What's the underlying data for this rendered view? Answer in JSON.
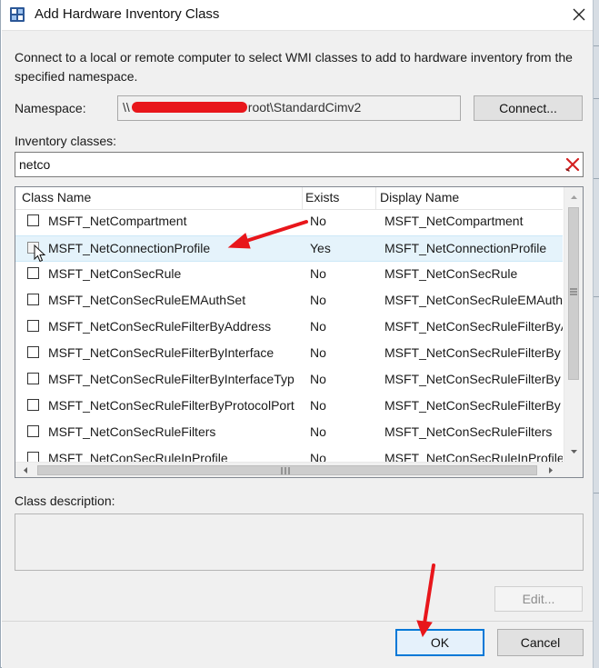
{
  "window": {
    "title": "Add Hardware Inventory Class",
    "close_glyph": "✕",
    "icon": "wmi-inventory-icon"
  },
  "intro": {
    "text": "Connect to a local or remote computer to select WMI classes to add to hardware inventory from the specified namespace."
  },
  "namespace": {
    "label": "Namespace:",
    "value_prefix": "\\\\",
    "value_suffix": "root\\StandardCimv2",
    "redacted": true,
    "connect_label": "Connect..."
  },
  "inventory": {
    "label": "Inventory classes:",
    "filter_value": "netco",
    "clear_icon": "clear-filter-icon"
  },
  "table": {
    "columns": [
      "Class Name",
      "Exists",
      "Display Name"
    ],
    "rows": [
      {
        "name": "MSFT_NetCompartment",
        "exists": "No",
        "display": "MSFT_NetCompartment",
        "checked": false,
        "selected": false
      },
      {
        "name": "MSFT_NetConnectionProfile",
        "exists": "Yes",
        "display": "MSFT_NetConnectionProfile",
        "checked": false,
        "selected": true
      },
      {
        "name": "MSFT_NetConSecRule",
        "exists": "No",
        "display": "MSFT_NetConSecRule",
        "checked": false,
        "selected": false
      },
      {
        "name": "MSFT_NetConSecRuleEMAuthSet",
        "exists": "No",
        "display": "MSFT_NetConSecRuleEMAuth",
        "checked": false,
        "selected": false
      },
      {
        "name": "MSFT_NetConSecRuleFilterByAddress",
        "exists": "No",
        "display": "MSFT_NetConSecRuleFilterByA",
        "checked": false,
        "selected": false
      },
      {
        "name": "MSFT_NetConSecRuleFilterByInterface",
        "exists": "No",
        "display": "MSFT_NetConSecRuleFilterBy",
        "checked": false,
        "selected": false
      },
      {
        "name": "MSFT_NetConSecRuleFilterByInterfaceTyp",
        "exists": "No",
        "display": "MSFT_NetConSecRuleFilterBy",
        "checked": false,
        "selected": false
      },
      {
        "name": "MSFT_NetConSecRuleFilterByProtocolPort",
        "exists": "No",
        "display": "MSFT_NetConSecRuleFilterBy",
        "checked": false,
        "selected": false
      },
      {
        "name": "MSFT_NetConSecRuleFilters",
        "exists": "No",
        "display": "MSFT_NetConSecRuleFilters",
        "checked": false,
        "selected": false
      },
      {
        "name": "MSFT_NetConSecRuleInProfile",
        "exists": "No",
        "display": "MSFT_NetConSecRuleInProfile",
        "checked": false,
        "selected": false
      }
    ]
  },
  "description": {
    "label": "Class description:",
    "text": ""
  },
  "buttons": {
    "edit": "Edit...",
    "ok": "OK",
    "cancel": "Cancel"
  },
  "annotations": {
    "arrow_color": "#e8161b"
  },
  "colors": {
    "accent": "#0078d7",
    "selection": "#e5f3fb",
    "redaction": "#e8161b"
  }
}
